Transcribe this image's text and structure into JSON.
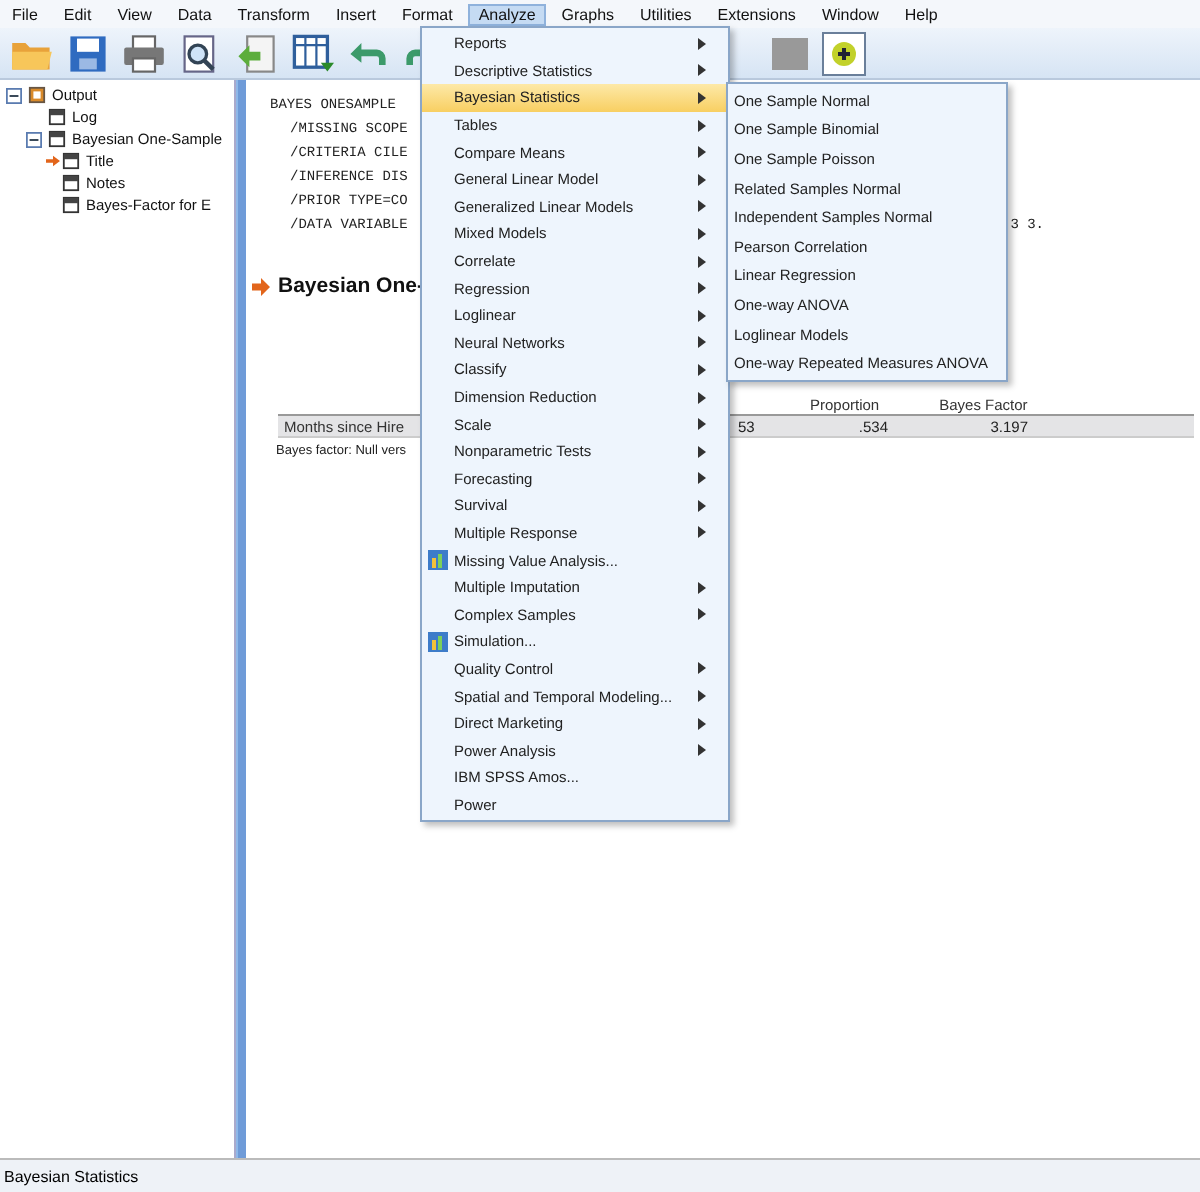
{
  "menu_bar": [
    {
      "label": "File",
      "selected": false
    },
    {
      "label": "Edit",
      "selected": false
    },
    {
      "label": "View",
      "selected": false
    },
    {
      "label": "Data",
      "selected": false
    },
    {
      "label": "Transform",
      "selected": false
    },
    {
      "label": "Insert",
      "selected": false
    },
    {
      "label": "Format",
      "selected": false
    },
    {
      "label": "Analyze",
      "selected": true
    },
    {
      "label": "Graphs",
      "selected": false
    },
    {
      "label": "Utilities",
      "selected": false
    },
    {
      "label": "Extensions",
      "selected": false
    },
    {
      "label": "Window",
      "selected": false
    },
    {
      "label": "Help",
      "selected": false
    }
  ],
  "outline": [
    {
      "label": "Output",
      "expanded": true,
      "children": [
        {
          "label": "Log",
          "current": false
        },
        {
          "label": "Bayesian One-Sample",
          "expanded": true,
          "current": false,
          "children": [
            {
              "label": "Title",
              "current": true
            },
            {
              "label": "Notes",
              "current": false
            },
            {
              "label": "Bayes-Factor for E",
              "current": false
            }
          ]
        }
      ]
    }
  ],
  "syntax": [
    {
      "text": "BAYES ONESAMPLE"
    },
    {
      "text": "/MISSING SCOPE"
    },
    {
      "text": "/CRITERIA CILE"
    },
    {
      "text": "/INFERENCE DIS"
    },
    {
      "text": "/PRIOR TYPE=CO"
    },
    {
      "text": "/DATA VARIABLE",
      "tail": "3 3."
    }
  ],
  "heading": "Bayesian One-",
  "table": {
    "header": [
      "Proportion",
      "Bayes Factor"
    ],
    "row": {
      "label": "Months since Hire",
      "cells": [
        "53",
        ".534",
        "3.197"
      ]
    },
    "footnote": "Bayes factor: Null vers"
  },
  "analyze_menu": [
    {
      "label": "Reports",
      "kind": "submenu",
      "selected": false
    },
    {
      "label": "Descriptive Statistics",
      "kind": "submenu",
      "selected": false
    },
    {
      "label": "Bayesian Statistics",
      "kind": "submenu",
      "selected": true
    },
    {
      "label": "Tables",
      "kind": "submenu",
      "selected": false
    },
    {
      "label": "Compare Means",
      "kind": "submenu",
      "selected": false
    },
    {
      "label": "General Linear Model",
      "kind": "submenu",
      "selected": false
    },
    {
      "label": "Generalized Linear Models",
      "kind": "submenu",
      "selected": false
    },
    {
      "label": "Mixed Models",
      "kind": "submenu",
      "selected": false
    },
    {
      "label": "Correlate",
      "kind": "submenu",
      "selected": false
    },
    {
      "label": "Regression",
      "kind": "submenu",
      "selected": false
    },
    {
      "label": "Loglinear",
      "kind": "submenu",
      "selected": false
    },
    {
      "label": "Neural Networks",
      "kind": "submenu",
      "selected": false
    },
    {
      "label": "Classify",
      "kind": "submenu",
      "selected": false
    },
    {
      "label": "Dimension Reduction",
      "kind": "submenu",
      "selected": false
    },
    {
      "label": "Scale",
      "kind": "submenu",
      "selected": false
    },
    {
      "label": "Nonparametric Tests",
      "kind": "submenu",
      "selected": false
    },
    {
      "label": "Forecasting",
      "kind": "submenu",
      "selected": false
    },
    {
      "label": "Survival",
      "kind": "submenu",
      "selected": false
    },
    {
      "label": "Multiple Response",
      "kind": "submenu",
      "selected": false
    },
    {
      "label": "Missing Value Analysis...",
      "kind": "icon-command",
      "selected": false
    },
    {
      "label": "Multiple Imputation",
      "kind": "submenu",
      "selected": false
    },
    {
      "label": "Complex Samples",
      "kind": "submenu",
      "selected": false
    },
    {
      "label": "Simulation...",
      "kind": "icon-command",
      "selected": false
    },
    {
      "label": "Quality Control",
      "kind": "submenu",
      "selected": false
    },
    {
      "label": "Spatial and Temporal Modeling...",
      "kind": "submenu",
      "selected": false
    },
    {
      "label": "Direct Marketing",
      "kind": "submenu",
      "selected": false
    },
    {
      "label": "Power Analysis",
      "kind": "submenu",
      "selected": false
    },
    {
      "label": "IBM SPSS Amos...",
      "kind": "command",
      "selected": false
    },
    {
      "label": "Power",
      "kind": "command",
      "selected": false
    }
  ],
  "bayesian_submenu": [
    "One Sample Normal",
    "One Sample Binomial",
    "One Sample Poisson",
    "Related Samples Normal",
    "Independent Samples Normal",
    "Pearson Correlation",
    "Linear Regression",
    "One-way ANOVA",
    "Loglinear Models",
    "One-way Repeated Measures ANOVA"
  ],
  "status_bar": "Bayesian Statistics"
}
